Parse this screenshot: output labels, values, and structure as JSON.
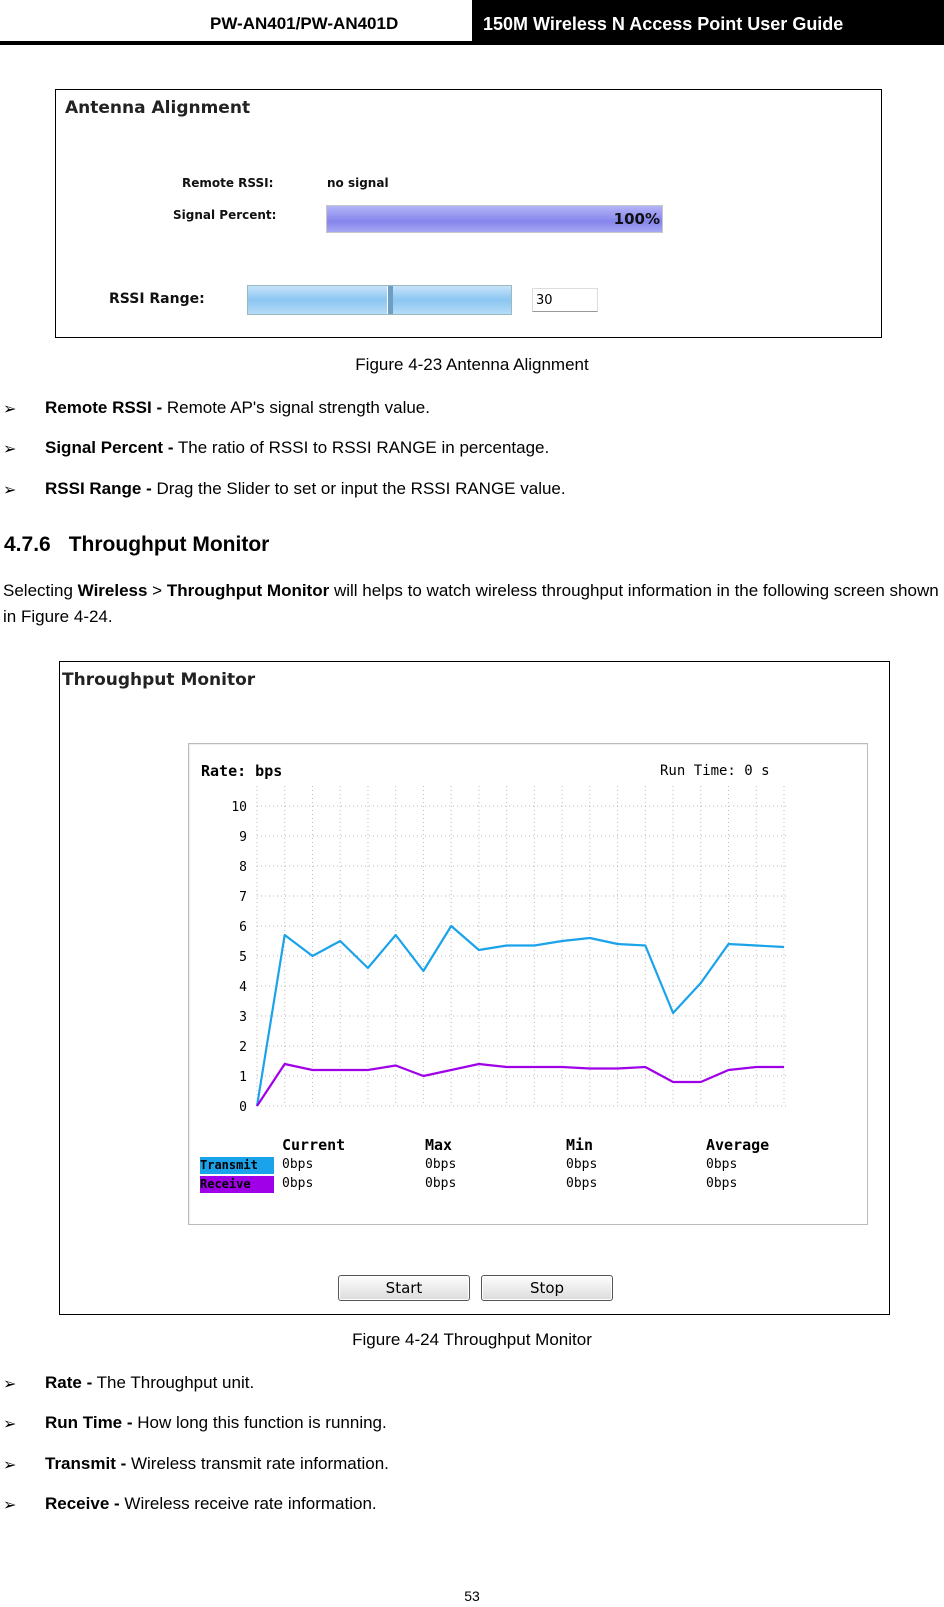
{
  "header": {
    "model": "PW-AN401/PW-AN401D",
    "guide_title": "150M Wireless N Access Point User Guide"
  },
  "antenna_figure": {
    "title": "Antenna Alignment",
    "remote_rssi_label": "Remote RSSI:",
    "remote_rssi_value": "no signal",
    "signal_percent_label": "Signal Percent:",
    "signal_percent_value": "100%",
    "signal_percent_level": 100,
    "rssi_range_label": "RSSI Range:",
    "rssi_range_value": "30",
    "bar_color": "#8f8ff0",
    "slider_color": "#8fc4f0"
  },
  "caption_23": "Figure 4-23 Antenna Alignment",
  "bullets_1": [
    {
      "term": "Remote RSSI -",
      "desc": " Remote AP's signal strength value."
    },
    {
      "term": "Signal Percent -",
      "desc": " The ratio of RSSI to RSSI RANGE in percentage."
    },
    {
      "term": "RSSI Range -",
      "desc": " Drag the Slider to set or input the RSSI RANGE value."
    }
  ],
  "section": {
    "number": "4.7.6",
    "title": "Throughput Monitor",
    "p_pre": "Selecting ",
    "p_b1": "Wireless",
    "p_mid": " > ",
    "p_b2": "Throughput Monitor",
    "p_post": " will helps to watch wireless throughput information in the following screen shown in Figure 4-24."
  },
  "throughput_figure": {
    "title": "Throughput Monitor",
    "rate_label": "Rate: bps",
    "run_time_label": "Run Time: 0 s",
    "stats_headers": [
      "Current",
      "Max",
      "Min",
      "Average"
    ],
    "rows": [
      {
        "name": "Transmit",
        "values": [
          "0bps",
          "0bps",
          "0bps",
          "0bps"
        ],
        "color": "#1aa3ea"
      },
      {
        "name": "Receive",
        "values": [
          "0bps",
          "0bps",
          "0bps",
          "0bps"
        ],
        "color": "#a000e8"
      }
    ],
    "start_button": "Start",
    "stop_button": "Stop"
  },
  "chart_data": {
    "type": "line",
    "ylim": [
      0,
      10
    ],
    "yticks": [
      "0",
      "1",
      "2",
      "3",
      "4",
      "5",
      "6",
      "7",
      "8",
      "9",
      "10"
    ],
    "x": [
      0,
      1,
      2,
      3,
      4,
      5,
      6,
      7,
      8,
      9,
      10,
      11,
      12,
      13,
      14,
      15,
      16,
      17,
      18,
      19
    ],
    "series": [
      {
        "name": "Transmit",
        "color": "#1aa3ea",
        "values": [
          0,
          5.7,
          5.0,
          5.5,
          4.6,
          5.7,
          4.5,
          6.0,
          5.2,
          5.35,
          5.35,
          5.5,
          5.6,
          5.4,
          5.35,
          3.1,
          4.1,
          5.4,
          5.35,
          5.3
        ]
      },
      {
        "name": "Receive",
        "color": "#a000e8",
        "values": [
          0,
          1.4,
          1.2,
          1.2,
          1.2,
          1.35,
          1.0,
          1.2,
          1.4,
          1.3,
          1.3,
          1.3,
          1.25,
          1.25,
          1.3,
          0.8,
          0.8,
          1.2,
          1.3,
          1.3
        ]
      }
    ]
  },
  "caption_24": "Figure 4-24 Throughput Monitor",
  "bullets_2": [
    {
      "term": "Rate -",
      "desc": " The Throughput unit."
    },
    {
      "term": "Run Time -",
      "desc": " How long this function is running."
    },
    {
      "term": "Transmit -",
      "desc": " Wireless transmit rate information."
    },
    {
      "term": "Receive -",
      "desc": " Wireless receive rate information."
    }
  ],
  "page_number": "53"
}
